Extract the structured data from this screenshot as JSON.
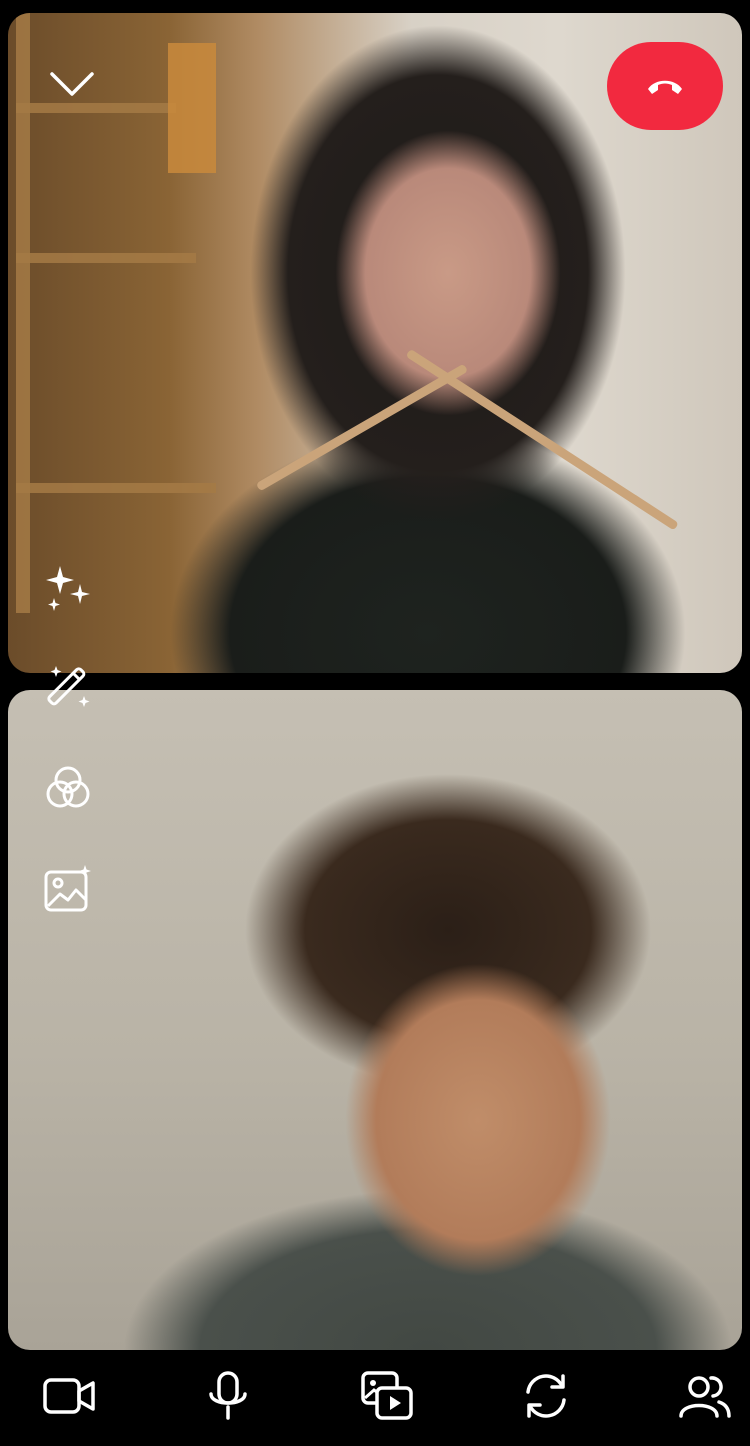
{
  "call": {
    "end_button_color": "#f2293f",
    "tiles": [
      {
        "participant": "remote-participant"
      },
      {
        "participant": "self-preview"
      }
    ]
  },
  "top_controls": {
    "collapse_icon": "chevron-down-icon",
    "end_call_icon": "hang-up-icon"
  },
  "side_tools": [
    {
      "icon": "sparkles-icon"
    },
    {
      "icon": "magic-wand-icon"
    },
    {
      "icon": "color-filter-icon"
    },
    {
      "icon": "background-image-icon"
    }
  ],
  "bottom_bar": [
    {
      "icon": "video-camera-icon"
    },
    {
      "icon": "microphone-icon"
    },
    {
      "icon": "media-share-icon"
    },
    {
      "icon": "flip-camera-icon"
    },
    {
      "icon": "participants-icon"
    }
  ]
}
